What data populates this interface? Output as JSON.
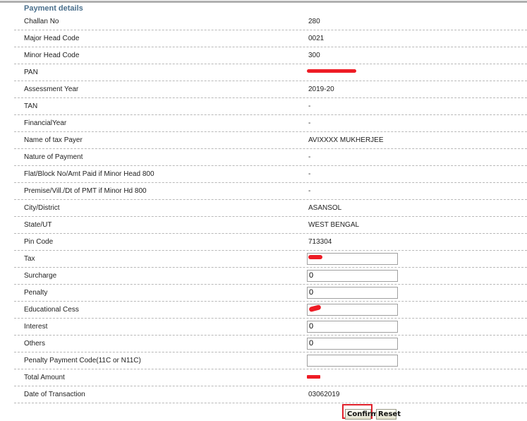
{
  "section": {
    "title": "Payment details"
  },
  "rows": [
    {
      "label": "Challan No",
      "value": "280",
      "type": "text"
    },
    {
      "label": "Major Head Code",
      "value": "0021",
      "type": "text"
    },
    {
      "label": "Minor Head Code",
      "value": "300",
      "type": "text"
    },
    {
      "label": "PAN",
      "value": "",
      "type": "redacted"
    },
    {
      "label": "Assessment Year",
      "value": "2019-20",
      "type": "text"
    },
    {
      "label": "TAN",
      "value": "-",
      "type": "text"
    },
    {
      "label": "FinancialYear",
      "value": "-",
      "type": "text"
    },
    {
      "label": "Name of tax Payer",
      "value": "AVIXXXX MUKHERJEE",
      "type": "text"
    },
    {
      "label": "Nature of Payment",
      "value": "-",
      "type": "text"
    },
    {
      "label": "Flat/Block No/Amt Paid if Minor Head 800",
      "value": "-",
      "type": "text"
    },
    {
      "label": "Premise/Vill./Dt of PMT if Minor Hd 800",
      "value": "-",
      "type": "text"
    },
    {
      "label": "City/District",
      "value": "ASANSOL",
      "type": "text"
    },
    {
      "label": "State/UT",
      "value": "WEST BENGAL",
      "type": "text"
    },
    {
      "label": "Pin Code",
      "value": "713304",
      "type": "text"
    },
    {
      "label": "Tax",
      "value": "",
      "type": "input-redacted"
    },
    {
      "label": "Surcharge",
      "value": "0",
      "type": "input"
    },
    {
      "label": "Penalty",
      "value": "0",
      "type": "input"
    },
    {
      "label": "Educational Cess",
      "value": "",
      "type": "input-redacted"
    },
    {
      "label": "Interest",
      "value": "0",
      "type": "input"
    },
    {
      "label": "Others",
      "value": "0",
      "type": "input"
    },
    {
      "label": "Penalty Payment Code(11C or N11C)",
      "value": "",
      "type": "input"
    },
    {
      "label": "Total Amount",
      "value": "",
      "type": "redacted"
    },
    {
      "label": "Date of Transaction",
      "value": "03062019",
      "type": "text"
    }
  ],
  "actions": {
    "confirm_label": "Confirm",
    "reset_label": "Reset"
  },
  "colors": {
    "section_title": "#4a6f8c",
    "redaction": "#ee1c25",
    "highlight": "#e0202a"
  }
}
